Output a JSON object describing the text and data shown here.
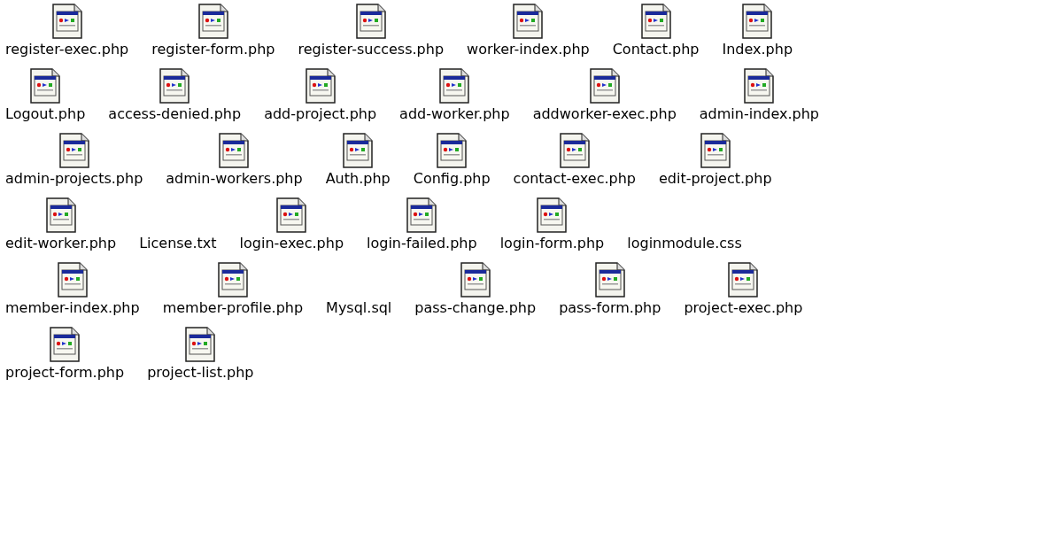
{
  "file_rows": [
    [
      {
        "name": "register-exec.php",
        "kind": "script"
      },
      {
        "name": "register-form.php",
        "kind": "script"
      },
      {
        "name": "register-success.php",
        "kind": "script"
      },
      {
        "name": "worker-index.php",
        "kind": "script"
      },
      {
        "name": "Contact.php",
        "kind": "script"
      },
      {
        "name": "Index.php",
        "kind": "script"
      }
    ],
    [
      {
        "name": "Logout.php",
        "kind": "script"
      },
      {
        "name": "access-denied.php",
        "kind": "script"
      },
      {
        "name": "add-project.php",
        "kind": "script"
      },
      {
        "name": "add-worker.php",
        "kind": "script"
      },
      {
        "name": "addworker-exec.php",
        "kind": "script"
      },
      {
        "name": "admin-index.php",
        "kind": "script"
      }
    ],
    [
      {
        "name": "admin-projects.php",
        "kind": "script"
      },
      {
        "name": "admin-workers.php",
        "kind": "script"
      },
      {
        "name": "Auth.php",
        "kind": "script"
      },
      {
        "name": "Config.php",
        "kind": "script"
      },
      {
        "name": "contact-exec.php",
        "kind": "script"
      },
      {
        "name": "edit-project.php",
        "kind": "script"
      }
    ],
    [
      {
        "name": "edit-worker.php",
        "kind": "script"
      },
      {
        "name": "License.txt",
        "kind": "plain"
      },
      {
        "name": "login-exec.php",
        "kind": "script"
      },
      {
        "name": "login-failed.php",
        "kind": "script"
      },
      {
        "name": "login-form.php",
        "kind": "script"
      },
      {
        "name": "loginmodule.css",
        "kind": "plain"
      }
    ],
    [
      {
        "name": "member-index.php",
        "kind": "script"
      },
      {
        "name": "member-profile.php",
        "kind": "script"
      },
      {
        "name": "Mysql.sql",
        "kind": "plain"
      },
      {
        "name": "pass-change.php",
        "kind": "script"
      },
      {
        "name": "pass-form.php",
        "kind": "script"
      },
      {
        "name": "project-exec.php",
        "kind": "script"
      }
    ],
    [
      {
        "name": "project-form.php",
        "kind": "script"
      },
      {
        "name": "project-list.php",
        "kind": "script"
      }
    ]
  ]
}
